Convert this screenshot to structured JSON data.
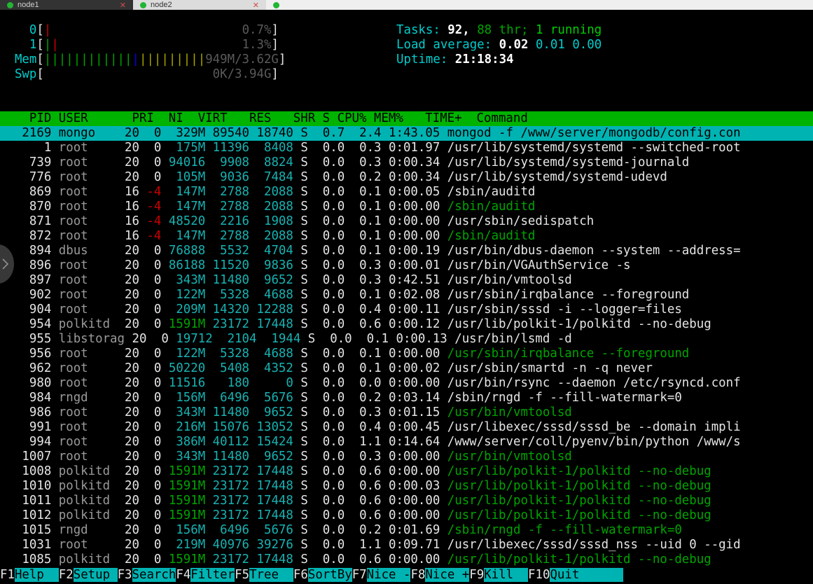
{
  "tabs": [
    {
      "label": "node1",
      "state": "inactive",
      "close": "✕"
    },
    {
      "label": "node2",
      "state": "active",
      "close": "✕"
    },
    {
      "label": "",
      "state": "stub",
      "close": ""
    }
  ],
  "meters": {
    "cpu": [
      {
        "id": "0",
        "pct": "0.7%",
        "bars": [
          {
            "color": "red",
            "n": 1
          }
        ]
      },
      {
        "id": "1",
        "pct": "1.3%",
        "bars": [
          {
            "color": "green",
            "n": 1
          },
          {
            "color": "red",
            "n": 1
          }
        ]
      }
    ],
    "mem": {
      "label": "Mem",
      "value": "949M/3.62G",
      "green": 12,
      "blue": 1,
      "olive": 9
    },
    "swp": {
      "label": "Swp",
      "value": "0K/3.94G",
      "green": 0,
      "blue": 0,
      "olive": 0
    }
  },
  "stats": {
    "tasks_label": "Tasks:",
    "tasks_count": " 92,",
    "threads": " 88 thr;",
    "running": " 1 running",
    "load_label": "Load average:",
    "load1": " 0.02",
    "load5": " 0.01",
    "load15": " 0.00",
    "uptime_label": "Uptime:",
    "uptime_value": " 21:18:34"
  },
  "columns": {
    "header": "    PID USER      PRI  NI  VIRT   RES   SHR S CPU% MEM%   TIME+  Command",
    "names": [
      "PID",
      "USER",
      "PRI",
      "NI",
      "VIRT",
      "RES",
      "SHR",
      "S",
      "CPU%",
      "MEM%",
      "TIME+",
      "Command"
    ]
  },
  "processes": [
    {
      "pid": "   2169",
      "user": "mongo   ",
      "pri": " 20",
      "ni": "  0",
      "virt": "  329M",
      "res": " 89540",
      "shr": " 18740",
      "s": " S",
      "cpu": "  0.7",
      "mem": "  2.4",
      "time": " 1:43.05",
      "cmd": "mongod -f /www/server/mongodb/config.con",
      "thread": false,
      "selected": true,
      "bigvirt": false,
      "negnice": false
    },
    {
      "pid": "      1",
      "user": "root    ",
      "pri": " 20",
      "ni": "  0",
      "virt": "  175M",
      "res": " 11396",
      "shr": "  8408",
      "s": " S",
      "cpu": "  0.0",
      "mem": "  0.3",
      "time": " 0:01.97",
      "cmd": "/usr/lib/systemd/systemd --switched-root",
      "thread": false,
      "selected": false,
      "bigvirt": false,
      "negnice": false
    },
    {
      "pid": "    739",
      "user": "root    ",
      "pri": " 20",
      "ni": "  0",
      "virt": " 94016",
      "res": "  9908",
      "shr": "  8824",
      "s": " S",
      "cpu": "  0.0",
      "mem": "  0.3",
      "time": " 0:00.34",
      "cmd": "/usr/lib/systemd/systemd-journald",
      "thread": false,
      "selected": false,
      "bigvirt": false,
      "negnice": false
    },
    {
      "pid": "    776",
      "user": "root    ",
      "pri": " 20",
      "ni": "  0",
      "virt": "  105M",
      "res": "  9036",
      "shr": "  7484",
      "s": " S",
      "cpu": "  0.0",
      "mem": "  0.2",
      "time": " 0:00.34",
      "cmd": "/usr/lib/systemd/systemd-udevd",
      "thread": false,
      "selected": false,
      "bigvirt": false,
      "negnice": false
    },
    {
      "pid": "    869",
      "user": "root    ",
      "pri": " 16",
      "ni": " -4",
      "virt": "  147M",
      "res": "  2788",
      "shr": "  2088",
      "s": " S",
      "cpu": "  0.0",
      "mem": "  0.1",
      "time": " 0:00.05",
      "cmd": "/sbin/auditd",
      "thread": false,
      "selected": false,
      "bigvirt": false,
      "negnice": true
    },
    {
      "pid": "    870",
      "user": "root    ",
      "pri": " 16",
      "ni": " -4",
      "virt": "  147M",
      "res": "  2788",
      "shr": "  2088",
      "s": " S",
      "cpu": "  0.0",
      "mem": "  0.1",
      "time": " 0:00.00",
      "cmd": "/sbin/auditd",
      "thread": true,
      "selected": false,
      "bigvirt": false,
      "negnice": true
    },
    {
      "pid": "    871",
      "user": "root    ",
      "pri": " 16",
      "ni": " -4",
      "virt": " 48520",
      "res": "  2216",
      "shr": "  1908",
      "s": " S",
      "cpu": "  0.0",
      "mem": "  0.1",
      "time": " 0:00.00",
      "cmd": "/usr/sbin/sedispatch",
      "thread": false,
      "selected": false,
      "bigvirt": false,
      "negnice": true
    },
    {
      "pid": "    872",
      "user": "root    ",
      "pri": " 16",
      "ni": " -4",
      "virt": "  147M",
      "res": "  2788",
      "shr": "  2088",
      "s": " S",
      "cpu": "  0.0",
      "mem": "  0.1",
      "time": " 0:00.00",
      "cmd": "/sbin/auditd",
      "thread": true,
      "selected": false,
      "bigvirt": false,
      "negnice": true
    },
    {
      "pid": "    894",
      "user": "dbus    ",
      "pri": " 20",
      "ni": "  0",
      "virt": " 76888",
      "res": "  5532",
      "shr": "  4704",
      "s": " S",
      "cpu": "  0.0",
      "mem": "  0.1",
      "time": " 0:00.19",
      "cmd": "/usr/bin/dbus-daemon --system --address=",
      "thread": false,
      "selected": false,
      "bigvirt": false,
      "negnice": false
    },
    {
      "pid": "    896",
      "user": "root    ",
      "pri": " 20",
      "ni": "  0",
      "virt": " 86188",
      "res": " 11520",
      "shr": "  9836",
      "s": " S",
      "cpu": "  0.0",
      "mem": "  0.3",
      "time": " 0:00.01",
      "cmd": "/usr/bin/VGAuthService -s",
      "thread": false,
      "selected": false,
      "bigvirt": false,
      "negnice": false
    },
    {
      "pid": "    897",
      "user": "root    ",
      "pri": " 20",
      "ni": "  0",
      "virt": "  343M",
      "res": " 11480",
      "shr": "  9652",
      "s": " S",
      "cpu": "  0.0",
      "mem": "  0.3",
      "time": " 0:42.51",
      "cmd": "/usr/bin/vmtoolsd",
      "thread": false,
      "selected": false,
      "bigvirt": false,
      "negnice": false
    },
    {
      "pid": "    902",
      "user": "root    ",
      "pri": " 20",
      "ni": "  0",
      "virt": "  122M",
      "res": "  5328",
      "shr": "  4688",
      "s": " S",
      "cpu": "  0.0",
      "mem": "  0.1",
      "time": " 0:02.08",
      "cmd": "/usr/sbin/irqbalance --foreground",
      "thread": false,
      "selected": false,
      "bigvirt": false,
      "negnice": false
    },
    {
      "pid": "    904",
      "user": "root    ",
      "pri": " 20",
      "ni": "  0",
      "virt": "  209M",
      "res": " 14320",
      "shr": " 12288",
      "s": " S",
      "cpu": "  0.0",
      "mem": "  0.4",
      "time": " 0:00.11",
      "cmd": "/usr/sbin/sssd -i --logger=files",
      "thread": false,
      "selected": false,
      "bigvirt": false,
      "negnice": false
    },
    {
      "pid": "    954",
      "user": "polkitd ",
      "pri": " 20",
      "ni": "  0",
      "virt": " 1591M",
      "res": " 23172",
      "shr": " 17448",
      "s": " S",
      "cpu": "  0.0",
      "mem": "  0.6",
      "time": " 0:00.12",
      "cmd": "/usr/lib/polkit-1/polkitd --no-debug",
      "thread": false,
      "selected": false,
      "bigvirt": true,
      "negnice": false
    },
    {
      "pid": "    955",
      "user": "libstorag",
      "pri": " 20",
      "ni": "  0",
      "virt": " 19712",
      "res": "  2104",
      "shr": "  1944",
      "s": " S",
      "cpu": "  0.0",
      "mem": "  0.1",
      "time": " 0:00.13",
      "cmd": "/usr/bin/lsmd -d",
      "thread": false,
      "selected": false,
      "bigvirt": false,
      "negnice": false
    },
    {
      "pid": "    956",
      "user": "root    ",
      "pri": " 20",
      "ni": "  0",
      "virt": "  122M",
      "res": "  5328",
      "shr": "  4688",
      "s": " S",
      "cpu": "  0.0",
      "mem": "  0.1",
      "time": " 0:00.00",
      "cmd": "/usr/sbin/irqbalance --foreground",
      "thread": true,
      "selected": false,
      "bigvirt": false,
      "negnice": false
    },
    {
      "pid": "    962",
      "user": "root    ",
      "pri": " 20",
      "ni": "  0",
      "virt": " 50220",
      "res": "  5408",
      "shr": "  4352",
      "s": " S",
      "cpu": "  0.0",
      "mem": "  0.1",
      "time": " 0:00.02",
      "cmd": "/usr/sbin/smartd -n -q never",
      "thread": false,
      "selected": false,
      "bigvirt": false,
      "negnice": false
    },
    {
      "pid": "    980",
      "user": "root    ",
      "pri": " 20",
      "ni": "  0",
      "virt": " 11516",
      "res": "   180",
      "shr": "     0",
      "s": " S",
      "cpu": "  0.0",
      "mem": "  0.0",
      "time": " 0:00.00",
      "cmd": "/usr/bin/rsync --daemon /etc/rsyncd.conf",
      "thread": false,
      "selected": false,
      "bigvirt": false,
      "negnice": false
    },
    {
      "pid": "    984",
      "user": "rngd    ",
      "pri": " 20",
      "ni": "  0",
      "virt": "  156M",
      "res": "  6496",
      "shr": "  5676",
      "s": " S",
      "cpu": "  0.0",
      "mem": "  0.2",
      "time": " 0:03.14",
      "cmd": "/sbin/rngd -f --fill-watermark=0",
      "thread": false,
      "selected": false,
      "bigvirt": false,
      "negnice": false
    },
    {
      "pid": "    986",
      "user": "root    ",
      "pri": " 20",
      "ni": "  0",
      "virt": "  343M",
      "res": " 11480",
      "shr": "  9652",
      "s": " S",
      "cpu": "  0.0",
      "mem": "  0.3",
      "time": " 0:01.15",
      "cmd": "/usr/bin/vmtoolsd",
      "thread": true,
      "selected": false,
      "bigvirt": false,
      "negnice": false
    },
    {
      "pid": "    991",
      "user": "root    ",
      "pri": " 20",
      "ni": "  0",
      "virt": "  216M",
      "res": " 15076",
      "shr": " 13052",
      "s": " S",
      "cpu": "  0.0",
      "mem": "  0.4",
      "time": " 0:00.45",
      "cmd": "/usr/libexec/sssd/sssd_be --domain impli",
      "thread": false,
      "selected": false,
      "bigvirt": false,
      "negnice": false
    },
    {
      "pid": "    994",
      "user": "root    ",
      "pri": " 20",
      "ni": "  0",
      "virt": "  386M",
      "res": " 40112",
      "shr": " 15424",
      "s": " S",
      "cpu": "  0.0",
      "mem": "  1.1",
      "time": " 0:14.64",
      "cmd": "/www/server/coll/pyenv/bin/python /www/s",
      "thread": false,
      "selected": false,
      "bigvirt": false,
      "negnice": false
    },
    {
      "pid": "   1007",
      "user": "root    ",
      "pri": " 20",
      "ni": "  0",
      "virt": "  343M",
      "res": " 11480",
      "shr": "  9652",
      "s": " S",
      "cpu": "  0.0",
      "mem": "  0.3",
      "time": " 0:00.00",
      "cmd": "/usr/bin/vmtoolsd",
      "thread": true,
      "selected": false,
      "bigvirt": false,
      "negnice": false
    },
    {
      "pid": "   1008",
      "user": "polkitd ",
      "pri": " 20",
      "ni": "  0",
      "virt": " 1591M",
      "res": " 23172",
      "shr": " 17448",
      "s": " S",
      "cpu": "  0.0",
      "mem": "  0.6",
      "time": " 0:00.00",
      "cmd": "/usr/lib/polkit-1/polkitd --no-debug",
      "thread": true,
      "selected": false,
      "bigvirt": true,
      "negnice": false
    },
    {
      "pid": "   1010",
      "user": "polkitd ",
      "pri": " 20",
      "ni": "  0",
      "virt": " 1591M",
      "res": " 23172",
      "shr": " 17448",
      "s": " S",
      "cpu": "  0.0",
      "mem": "  0.6",
      "time": " 0:00.03",
      "cmd": "/usr/lib/polkit-1/polkitd --no-debug",
      "thread": true,
      "selected": false,
      "bigvirt": true,
      "negnice": false
    },
    {
      "pid": "   1011",
      "user": "polkitd ",
      "pri": " 20",
      "ni": "  0",
      "virt": " 1591M",
      "res": " 23172",
      "shr": " 17448",
      "s": " S",
      "cpu": "  0.0",
      "mem": "  0.6",
      "time": " 0:00.00",
      "cmd": "/usr/lib/polkit-1/polkitd --no-debug",
      "thread": true,
      "selected": false,
      "bigvirt": true,
      "negnice": false
    },
    {
      "pid": "   1012",
      "user": "polkitd ",
      "pri": " 20",
      "ni": "  0",
      "virt": " 1591M",
      "res": " 23172",
      "shr": " 17448",
      "s": " S",
      "cpu": "  0.0",
      "mem": "  0.6",
      "time": " 0:00.00",
      "cmd": "/usr/lib/polkit-1/polkitd --no-debug",
      "thread": true,
      "selected": false,
      "bigvirt": true,
      "negnice": false
    },
    {
      "pid": "   1015",
      "user": "rngd    ",
      "pri": " 20",
      "ni": "  0",
      "virt": "  156M",
      "res": "  6496",
      "shr": "  5676",
      "s": " S",
      "cpu": "  0.0",
      "mem": "  0.2",
      "time": " 0:01.69",
      "cmd": "/sbin/rngd -f --fill-watermark=0",
      "thread": true,
      "selected": false,
      "bigvirt": false,
      "negnice": false
    },
    {
      "pid": "   1031",
      "user": "root    ",
      "pri": " 20",
      "ni": "  0",
      "virt": "  219M",
      "res": " 40976",
      "shr": " 39276",
      "s": " S",
      "cpu": "  0.0",
      "mem": "  1.1",
      "time": " 0:09.71",
      "cmd": "/usr/libexec/sssd/sssd_nss --uid 0 --gid",
      "thread": false,
      "selected": false,
      "bigvirt": false,
      "negnice": false
    },
    {
      "pid": "   1085",
      "user": "polkitd ",
      "pri": " 20",
      "ni": "  0",
      "virt": " 1591M",
      "res": " 23172",
      "shr": " 17448",
      "s": " S",
      "cpu": "  0.0",
      "mem": "  0.6",
      "time": " 0:00.00",
      "cmd": "/usr/lib/polkit-1/polkitd --no-debug",
      "thread": true,
      "selected": false,
      "bigvirt": true,
      "negnice": false
    }
  ],
  "fkeys": [
    {
      "num": "F1",
      "label": "Help  "
    },
    {
      "num": "F2",
      "label": "Setup "
    },
    {
      "num": "F3",
      "label": "Search"
    },
    {
      "num": "F4",
      "label": "Filter"
    },
    {
      "num": "F5",
      "label": "Tree  "
    },
    {
      "num": "F6",
      "label": "SortBy"
    },
    {
      "num": "F7",
      "label": "Nice -"
    },
    {
      "num": "F8",
      "label": "Nice +"
    },
    {
      "num": "F9",
      "label": "Kill  "
    },
    {
      "num": "F10",
      "label": "Quit      "
    }
  ],
  "colors": {
    "header_bg": "#00b300",
    "selected_bg": "#00b3b3",
    "fkey_bg": "#00b3b3",
    "cyan": "#00cdcd",
    "green": "#00a400",
    "red": "#cd0000",
    "terminal_bg": "#000000"
  }
}
